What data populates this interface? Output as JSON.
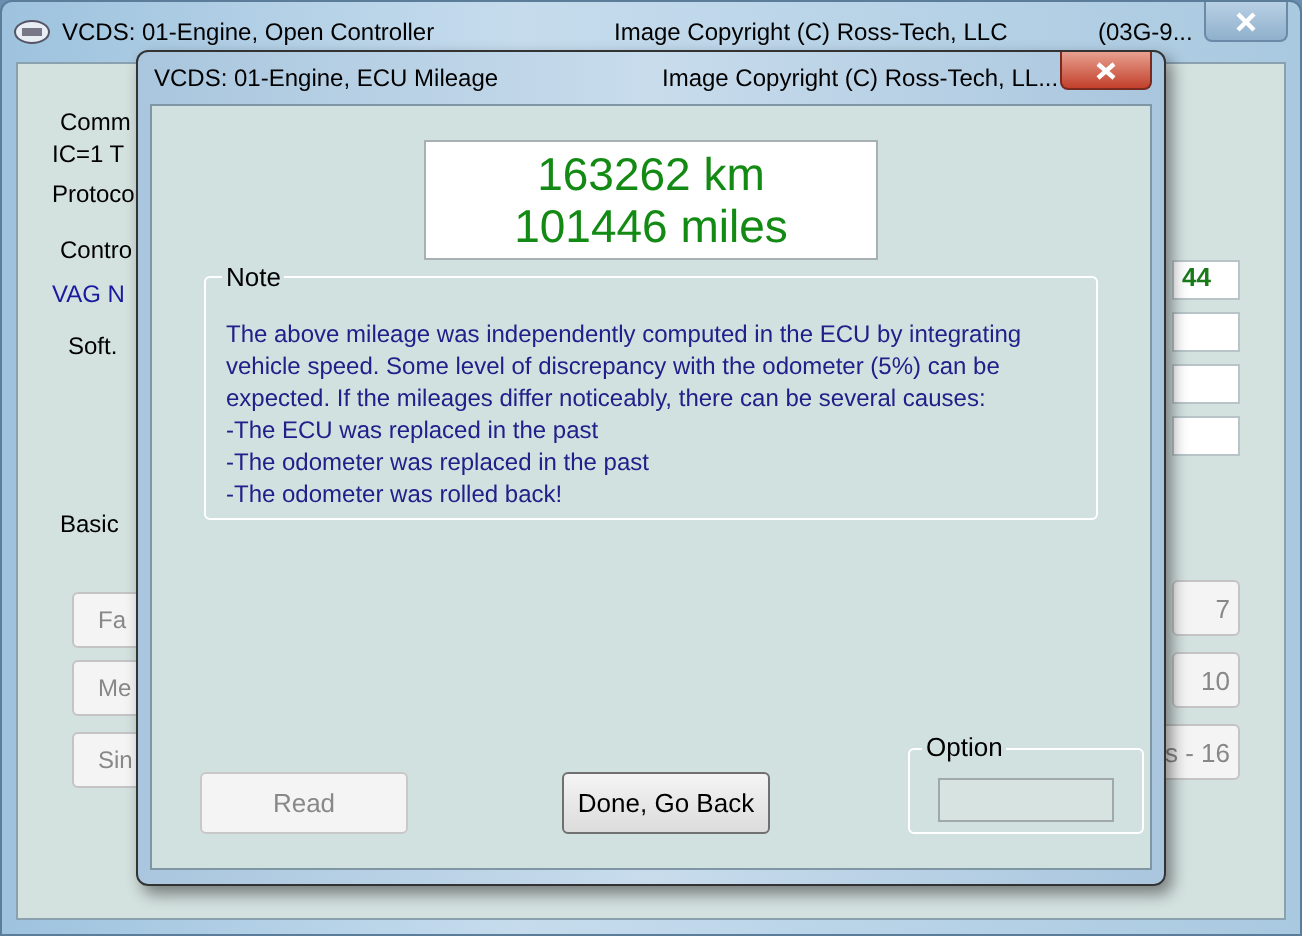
{
  "main_window": {
    "title": "VCDS: 01-Engine,  Open Controller",
    "copyright": "Image Copyright (C) Ross-Tech, LLC",
    "title_extra": "(03G-9...",
    "left_fragments": [
      {
        "kind": "group",
        "text": "Comm"
      },
      {
        "kind": "text",
        "text": "IC=1  T"
      },
      {
        "kind": "text",
        "text": "Protoco"
      },
      {
        "kind": "group",
        "text": "Contro"
      },
      {
        "kind": "link",
        "text": "VAG N"
      },
      {
        "kind": "text",
        "text": "Soft."
      },
      {
        "kind": "group",
        "text": "Basic"
      },
      {
        "kind": "button",
        "text": "Fa"
      },
      {
        "kind": "button",
        "text": "Me"
      },
      {
        "kind": "button",
        "text": "Sin"
      }
    ],
    "right_fragments": [
      {
        "kind": "field",
        "text": "44"
      },
      {
        "kind": "field"
      },
      {
        "kind": "field"
      },
      {
        "kind": "field"
      },
      {
        "kind": "button",
        "text": "7"
      },
      {
        "kind": "button",
        "text": "10"
      },
      {
        "kind": "button",
        "text": "s - 16"
      }
    ]
  },
  "dialog": {
    "title": "VCDS: 01-Engine,  ECU Mileage",
    "copyright": "Image Copyright (C) Ross-Tech, LL...",
    "mileage": [
      "163262 km",
      "101446 miles"
    ],
    "note": {
      "label": "Note",
      "paragraph": "The above mileage was independently computed in the ECU by integrating vehicle speed. Some level of discrepancy with the odometer (5%) can be expected. If the mileages differ noticeably, there can be several causes:",
      "causes": [
        "-The ECU was replaced in the past",
        "-The odometer was replaced in the past",
        "-The odometer was rolled back!"
      ]
    },
    "buttons": [
      {
        "label": "Read",
        "disabled": true
      },
      {
        "label": "Done, Go Back",
        "disabled": false
      }
    ],
    "option": {
      "label": "Option"
    }
  }
}
